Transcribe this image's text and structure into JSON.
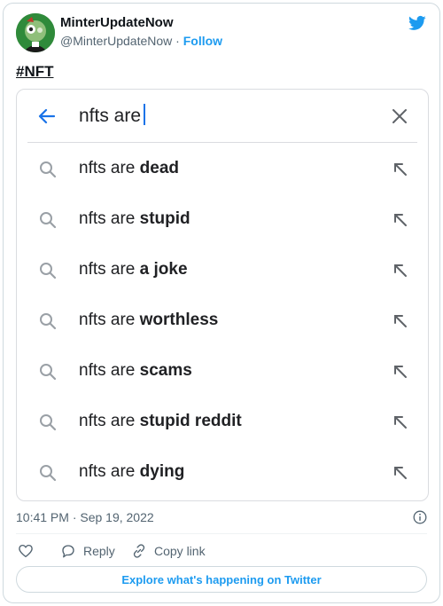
{
  "account": {
    "display_name": "MinterUpdateNow",
    "handle": "@MinterUpdateNow",
    "separator": " · ",
    "follow_label": "Follow"
  },
  "tweet": {
    "hashtag": "#NFT",
    "timestamp": "10:41 PM · Sep 19, 2022"
  },
  "search_card": {
    "query": "nfts are",
    "suggestions": [
      {
        "prefix": "nfts are ",
        "completion": "dead"
      },
      {
        "prefix": "nfts are ",
        "completion": "stupid"
      },
      {
        "prefix": "nfts are ",
        "completion": "a joke"
      },
      {
        "prefix": "nfts are ",
        "completion": "worthless"
      },
      {
        "prefix": "nfts are ",
        "completion": "scams"
      },
      {
        "prefix": "nfts are ",
        "completion": "stupid reddit"
      },
      {
        "prefix": "nfts are ",
        "completion": "dying"
      }
    ]
  },
  "actions": {
    "reply_label": "Reply",
    "copy_link_label": "Copy link"
  },
  "explore_label": "Explore what's happening on Twitter",
  "icons": {
    "brand": "twitter-bird-icon",
    "back": "arrow-left-icon",
    "clear": "close-icon",
    "suggest": "search-icon",
    "fill": "arrow-up-left-icon",
    "info": "info-icon",
    "like": "heart-icon",
    "reply": "speech-bubble-icon",
    "copy": "link-icon"
  },
  "colors": {
    "twitter_blue": "#1d9bf0",
    "google_blue": "#1a73e8",
    "avatar_green": "#2f8a3a"
  }
}
